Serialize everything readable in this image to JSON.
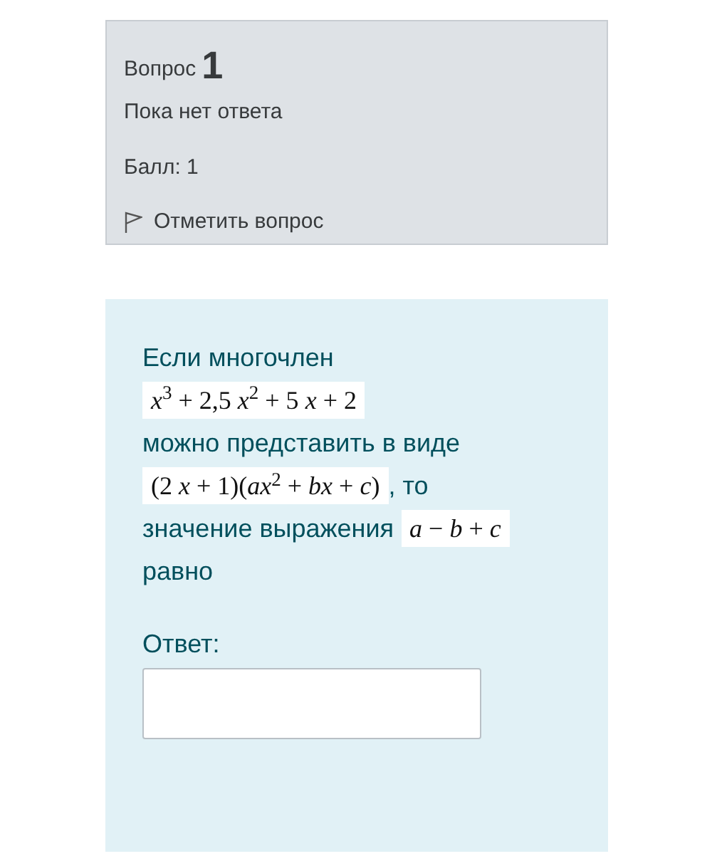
{
  "info": {
    "question_label": "Вопрос",
    "question_number": "1",
    "status": "Пока нет ответа",
    "score": "Балл: 1",
    "flag_link": "Отметить вопрос"
  },
  "question": {
    "segments": [
      {
        "kind": "text",
        "text": "Если многочлен"
      },
      {
        "kind": "formula",
        "text": "*x*$^{3}$ + 2,5 *x*$^{2}$ + 5 *x* + 2"
      },
      {
        "kind": "text",
        "text": "можно представить в виде"
      },
      {
        "kind": "formula",
        "text": "(2 *x* + 1)(*ax*$^{2}$ + *bx* + *c*)"
      },
      {
        "kind": "text",
        "text": ", то"
      },
      {
        "kind": "text",
        "text": "значение выражения"
      },
      {
        "kind": "formula",
        "text": "*a* − *b* + *c*"
      },
      {
        "kind": "text",
        "text": "равно"
      }
    ],
    "answer_label": "Ответ:"
  }
}
